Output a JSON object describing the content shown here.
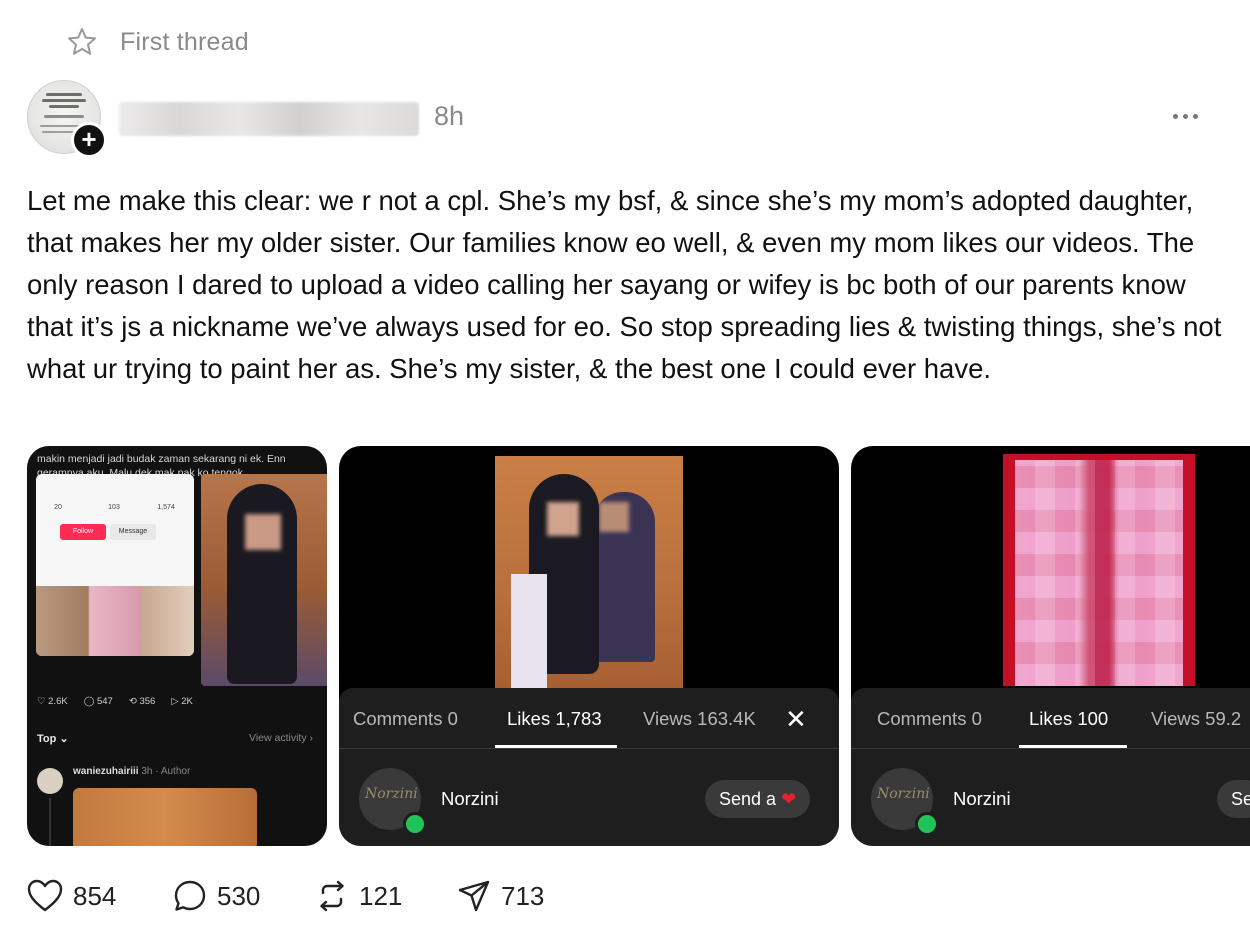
{
  "thread_label": "First thread",
  "post": {
    "timestamp": "8h",
    "text": "Let me make this clear: we r not a cpl. She’s my bsf, & since she’s my mom’s adopted daughter, that makes her my older sister. Our families know eo well, & even my mom likes our videos. The only reason I dared to upload a video calling her sayang or wifey is bc both of our parents know that it’s js a nickname we’ve always used for eo. So stop spreading lies & twisting things, she’s not what ur trying to paint her as. She’s my sister, & the best one I could ever have."
  },
  "media": {
    "card1": {
      "caption": "makin menjadi jadi budak zaman sekarang ni ek. Enn geramnya aku. Malu dek mak pak ko tengok",
      "profile_stats": [
        "20",
        "103",
        "1,574"
      ],
      "follow_label": "Follow",
      "message_label": "Message",
      "stats": [
        "2.6K",
        "547",
        "356",
        "2K"
      ],
      "sort_label": "Top",
      "view_activity": "View activity",
      "reply_user": "waniezuhairiii",
      "reply_meta": "3h · Author"
    },
    "card2": {
      "tabs": [
        "Comments 0",
        "Likes 1,783",
        "Views 163.4K"
      ],
      "user": "Norzini",
      "avatar_logo": "Norzini",
      "send_label": "Send a",
      "send_emoji": "❤️"
    },
    "card3": {
      "tabs": [
        "Comments 0",
        "Likes 100",
        "Views 59.2"
      ],
      "user": "Norzini",
      "avatar_logo": "Norzini",
      "send_label": "Se"
    }
  },
  "actions": {
    "likes": "854",
    "replies": "530",
    "reposts": "121",
    "shares": "713"
  },
  "icons": [
    "star-icon",
    "plus-icon",
    "more-icon",
    "heart-icon",
    "comment-icon",
    "repost-icon",
    "send-icon",
    "close-icon"
  ]
}
